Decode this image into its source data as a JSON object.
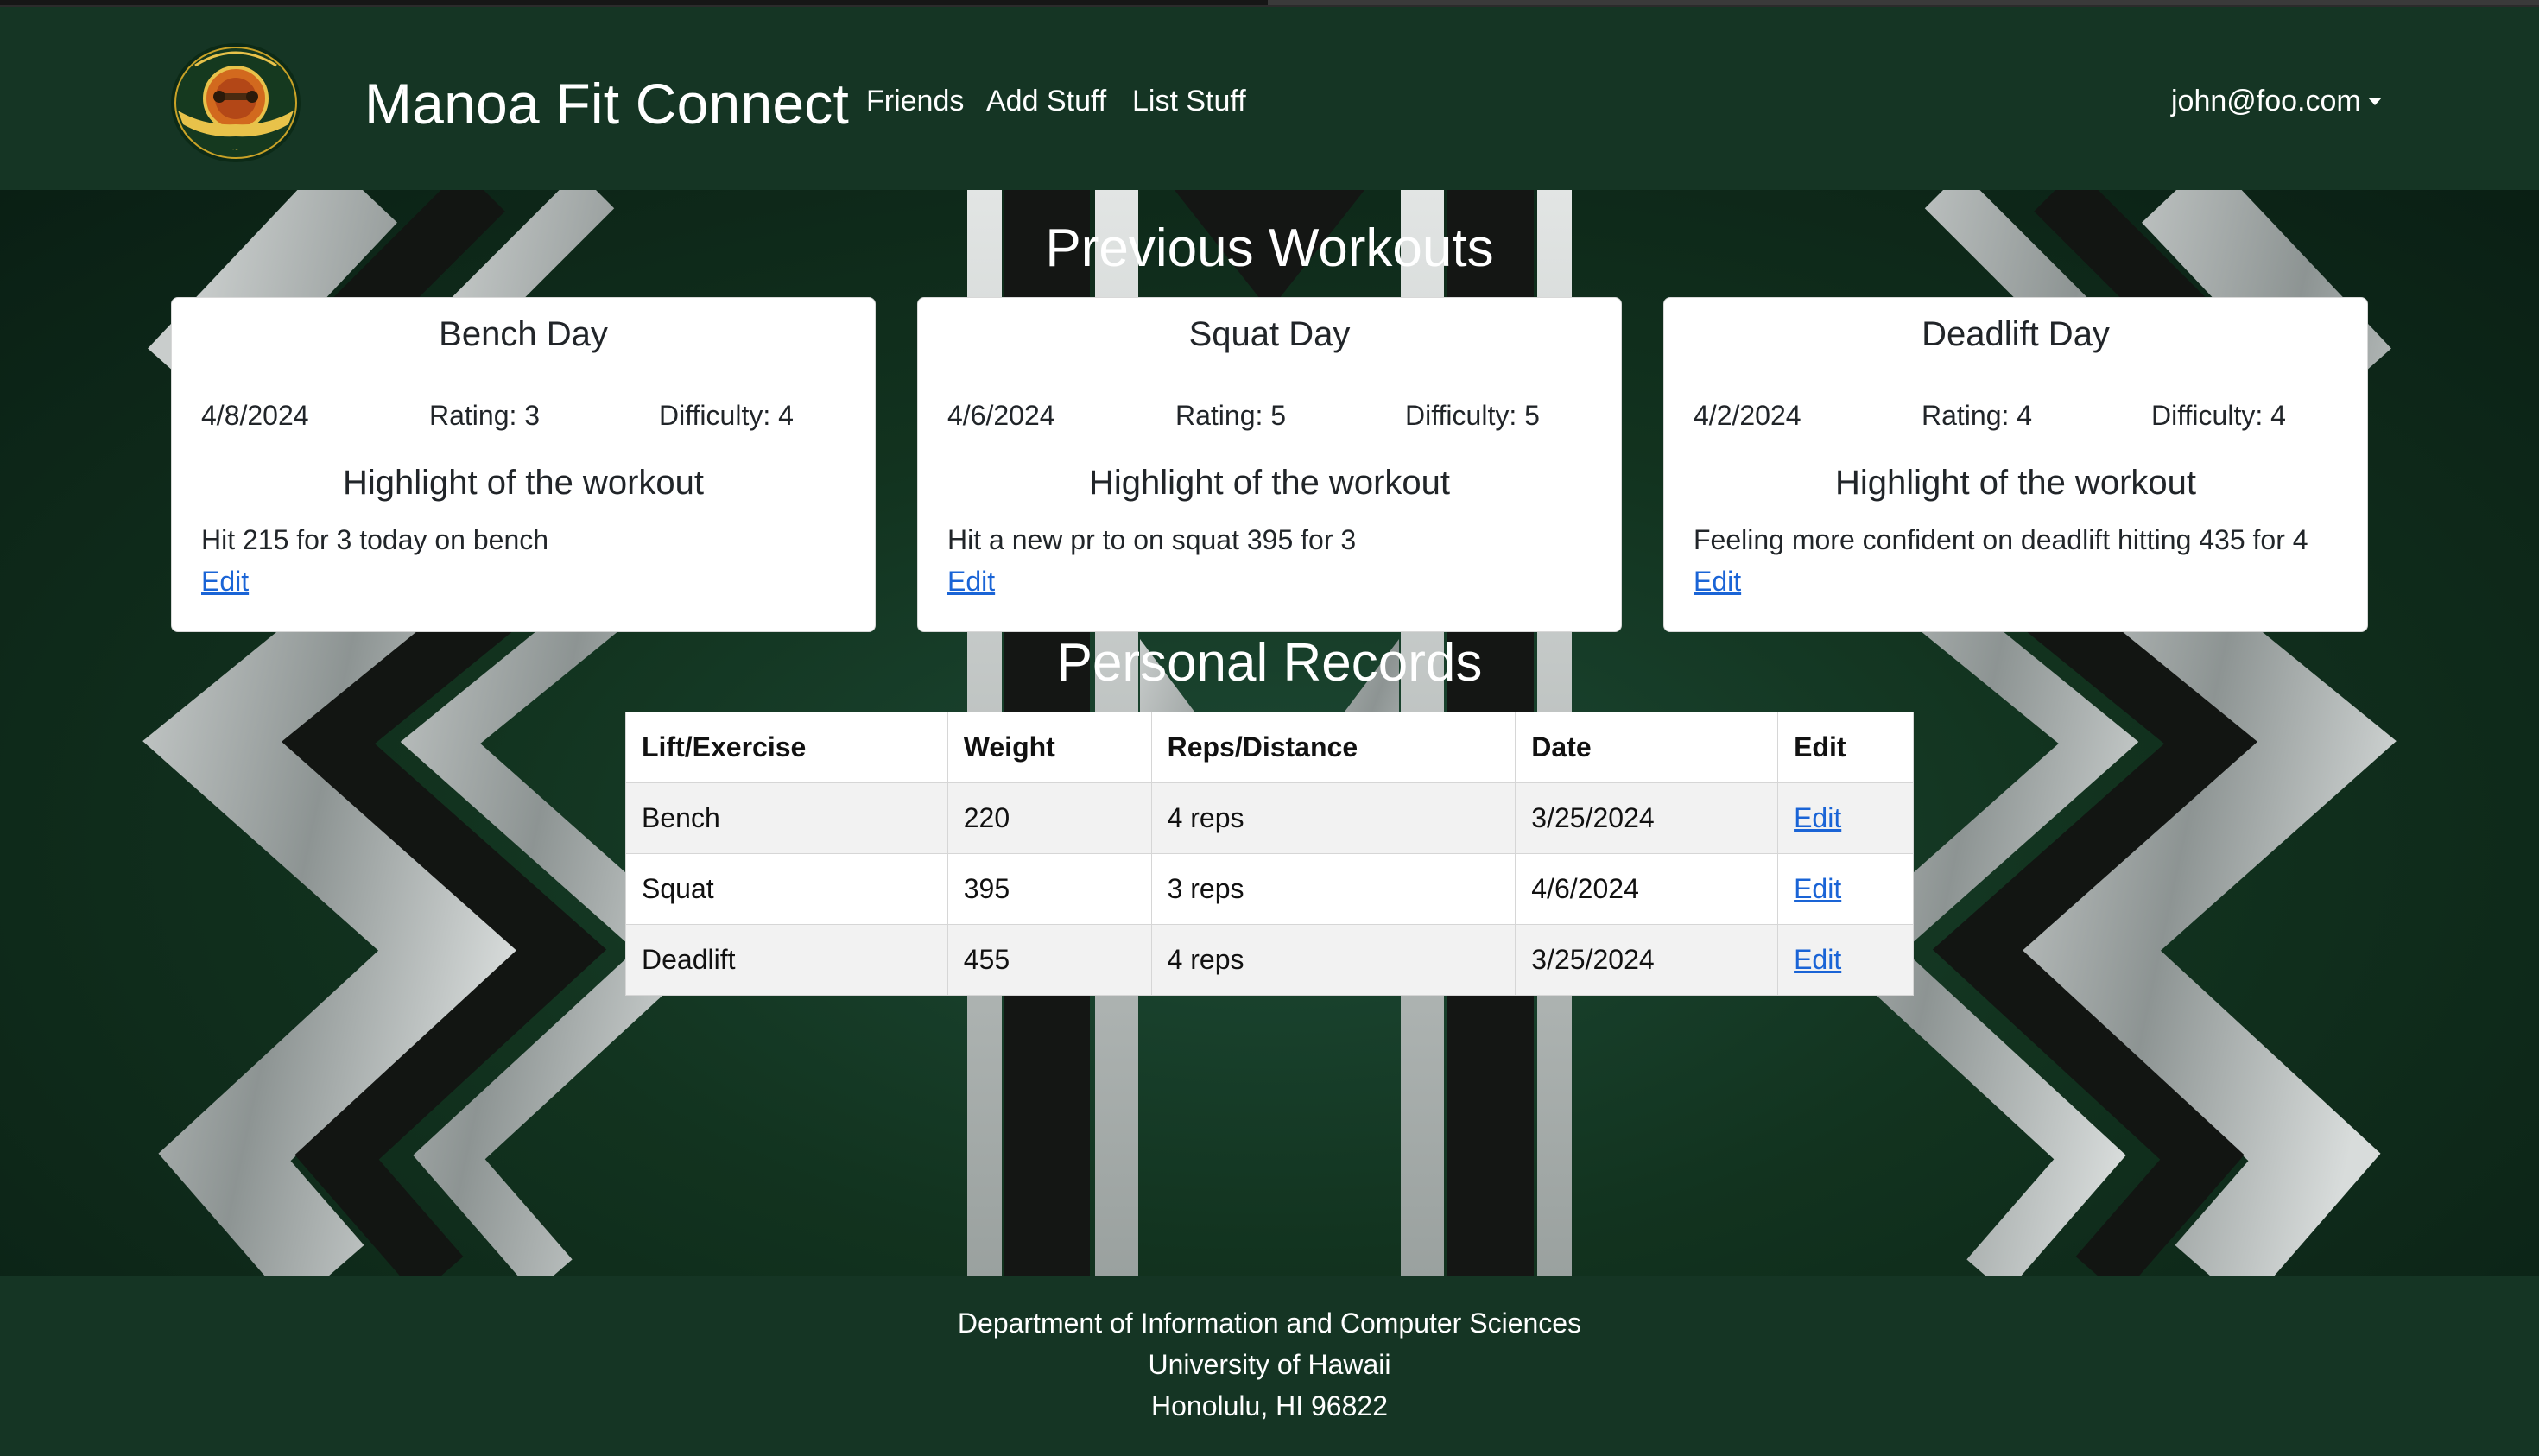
{
  "navbar": {
    "brand": "Manoa Fit Connect",
    "links": [
      "Friends",
      "Add Stuff",
      "List Stuff"
    ],
    "user": "john@foo.com",
    "logo_text": "MANOA FIT CONNECT"
  },
  "workouts": {
    "title": "Previous Workouts",
    "cards": [
      {
        "title": "Bench Day",
        "date": "4/8/2024",
        "rating": "Rating: 3",
        "difficulty": "Difficulty: 4",
        "subtitle": "Highlight of the workout",
        "text": "Hit 215 for 3 today on bench",
        "edit": "Edit"
      },
      {
        "title": "Squat Day",
        "date": "4/6/2024",
        "rating": "Rating: 5",
        "difficulty": "Difficulty: 5",
        "subtitle": "Highlight of the workout",
        "text": "Hit a new pr to on squat 395 for 3",
        "edit": "Edit"
      },
      {
        "title": "Deadlift Day",
        "date": "4/2/2024",
        "rating": "Rating: 4",
        "difficulty": "Difficulty: 4",
        "subtitle": "Highlight of the workout",
        "text": "Feeling more confident on deadlift hitting 435 for 4",
        "edit": "Edit"
      }
    ]
  },
  "records": {
    "title": "Personal Records",
    "headers": [
      "Lift/Exercise",
      "Weight",
      "Reps/Distance",
      "Date",
      "Edit"
    ],
    "rows": [
      [
        "Bench",
        "220",
        "4 reps",
        "3/25/2024",
        "Edit"
      ],
      [
        "Squat",
        "395",
        "3 reps",
        "4/6/2024",
        "Edit"
      ],
      [
        "Deadlift",
        "455",
        "4 reps",
        "3/25/2024",
        "Edit"
      ]
    ]
  },
  "footer": {
    "line1": "Department of Information and Computer Sciences",
    "line2": "University of Hawaii",
    "line3": "Honolulu, HI 96822"
  },
  "colors": {
    "navbar_bg": "#153524",
    "link_blue": "#1a64d6",
    "background_green": "#1d4a35"
  }
}
